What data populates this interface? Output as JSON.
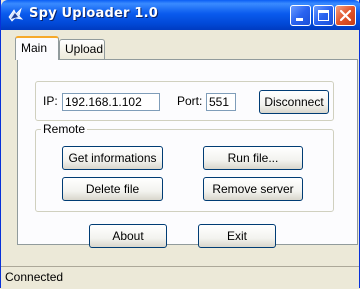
{
  "window": {
    "title": "Spy Uploader 1.0",
    "controls": [
      "minimize-icon",
      "maximize-icon",
      "close-icon"
    ]
  },
  "tabs": [
    {
      "label": "Main",
      "selected": true
    },
    {
      "label": "Upload",
      "selected": false
    }
  ],
  "connection": {
    "ip_label": "IP:",
    "ip_value": "192.168.1.102",
    "port_label": "Port:",
    "port_value": "551",
    "disconnect_label": "Disconnect"
  },
  "remote": {
    "legend": "Remote",
    "get_info_label": "Get informations",
    "run_file_label": "Run file...",
    "delete_file_label": "Delete file",
    "remove_server_label": "Remove server"
  },
  "footer_buttons": {
    "about_label": "About",
    "exit_label": "Exit"
  },
  "status": {
    "text": "Connected"
  },
  "colors": {
    "titlebar": "#0a5bee",
    "face": "#ece9d8",
    "tab_accent": "#f6a92a",
    "button_border": "#003c74",
    "close_button": "#e1542a"
  }
}
